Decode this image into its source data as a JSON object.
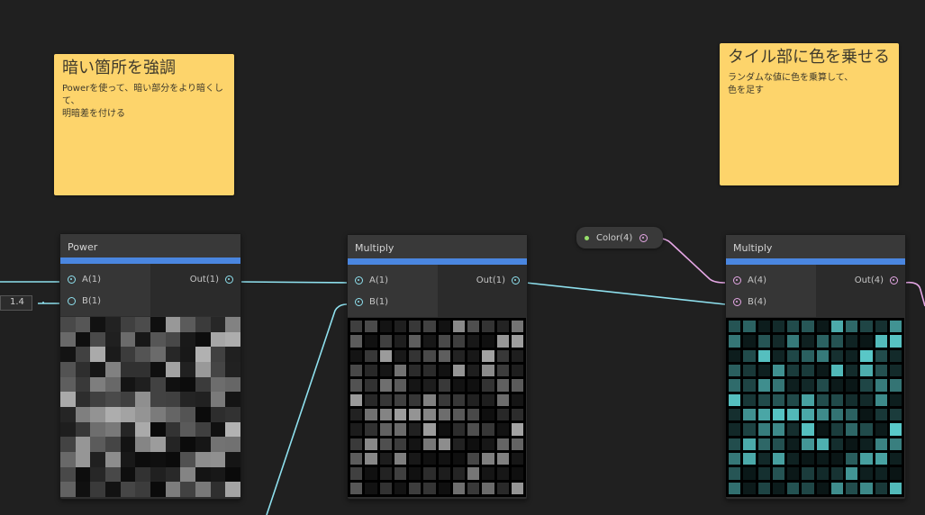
{
  "notes": [
    {
      "title": "暗い箇所を強調",
      "body": "Powerを使って、暗い部分をより暗くして、\n明暗差を付ける"
    },
    {
      "title": "タイル部に色を乗せる",
      "body": "ランダムな値に色を乗算して、\n色を足す"
    }
  ],
  "nodes": {
    "power": {
      "title": "Power",
      "in_a": "A(1)",
      "in_b": "B(1)",
      "out": "Out(1)",
      "b_value": "1.4"
    },
    "multiply1": {
      "title": "Multiply",
      "in_a": "A(1)",
      "in_b": "B(1)",
      "out": "Out(1)"
    },
    "multiply2": {
      "title": "Multiply",
      "in_a": "A(4)",
      "in_b": "B(4)",
      "out": "Out(4)"
    }
  },
  "color_property": {
    "label": "Color(4)"
  },
  "colors": {
    "background": "#202020",
    "accent_bar": "#4a86e0",
    "note_yellow": "#fdd46b",
    "wire_cyan": "#8ee0ee",
    "wire_pink": "#e5a7e5",
    "tile_teal": "#5fd6d6"
  }
}
